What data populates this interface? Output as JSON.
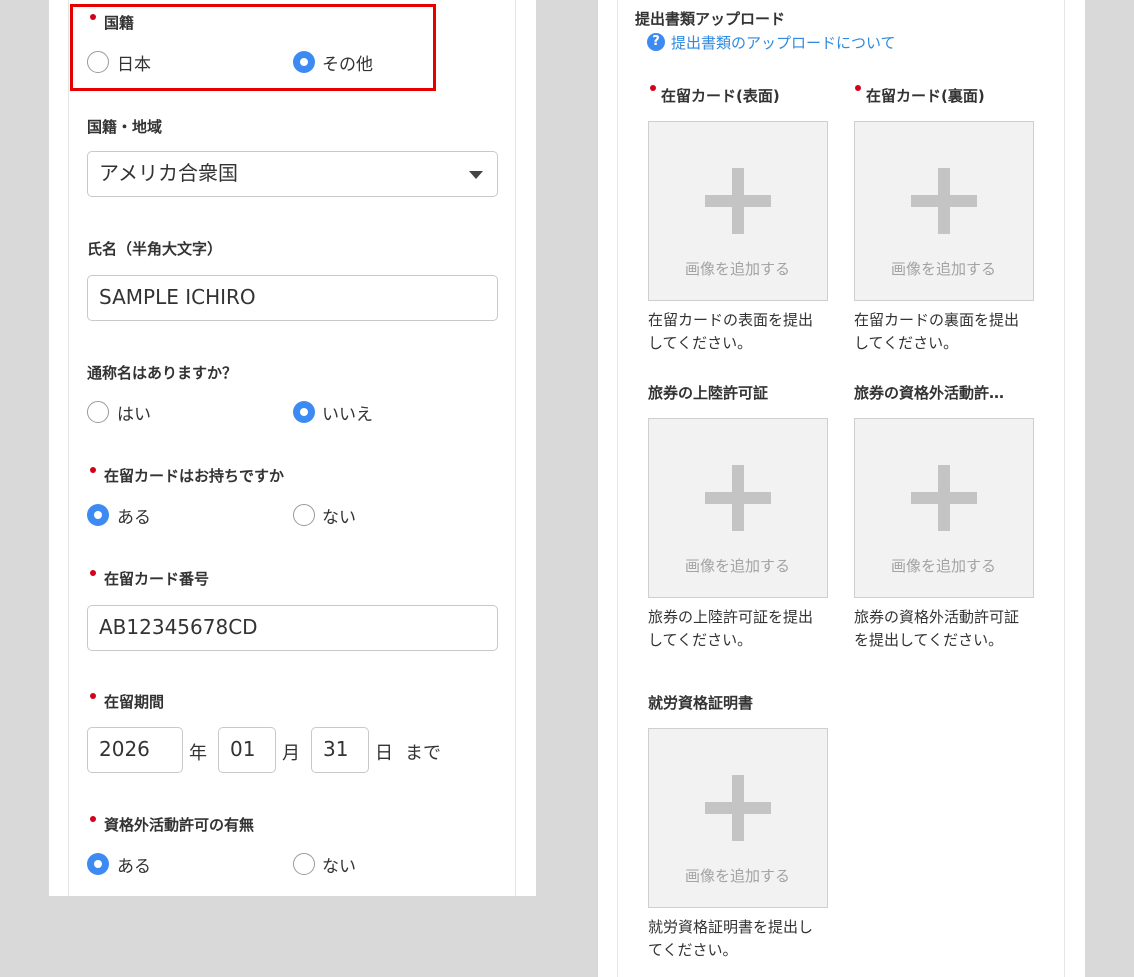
{
  "left_form": {
    "nationality": {
      "label": "国籍",
      "options": [
        "日本",
        "その他"
      ],
      "selected": "その他"
    },
    "region": {
      "label": "国籍・地域",
      "value": "アメリカ合衆国"
    },
    "name": {
      "label": "氏名（半角大文字）",
      "value": "SAMPLE ICHIRO"
    },
    "alias": {
      "label": "通称名はありますか？",
      "options": [
        "はい",
        "いいえ"
      ],
      "selected": "いいえ"
    },
    "has_card": {
      "label": "在留カードはお持ちですか",
      "options": [
        "ある",
        "ない"
      ],
      "selected": "ある"
    },
    "card_number": {
      "label": "在留カード番号",
      "value": "AB12345678CD"
    },
    "period": {
      "label": "在留期間",
      "year": "2026",
      "year_unit": "年",
      "month": "01",
      "month_unit": "月",
      "day": "31",
      "day_unit": "日",
      "suffix": "まで"
    },
    "work_permit": {
      "label": "資格外活動許可の有無",
      "options": [
        "ある",
        "ない"
      ],
      "selected": "ある"
    }
  },
  "uploads": {
    "heading": "提出書類アップロード",
    "help_icon": "?",
    "help_link": "提出書類のアップロードについて",
    "add_image_text": "画像を追加する",
    "items": [
      {
        "title": "在留カード(表面)",
        "required": true,
        "caption_lines": [
          "在留カードの表面を提出",
          "してください。"
        ]
      },
      {
        "title": "在留カード(裏面)",
        "required": true,
        "caption_lines": [
          "在留カードの裏面を提出",
          "してください。"
        ]
      },
      {
        "title": "旅券の上陸許可証",
        "required": false,
        "caption_lines": [
          "旅券の上陸許可証を提出",
          "してください。"
        ]
      },
      {
        "title": "旅券の資格外活動許…",
        "required": false,
        "caption_lines": [
          "旅券の資格外活動許可証",
          "を提出してください。"
        ]
      },
      {
        "title": "就労資格証明書",
        "required": false,
        "caption_lines": [
          "就労資格証明書を提出し",
          "てください。"
        ]
      }
    ]
  },
  "colors": {
    "accent": "#3d8bf2",
    "required_dot": "#d0021b",
    "highlight_border": "#e60000",
    "link": "#2f8adf"
  }
}
